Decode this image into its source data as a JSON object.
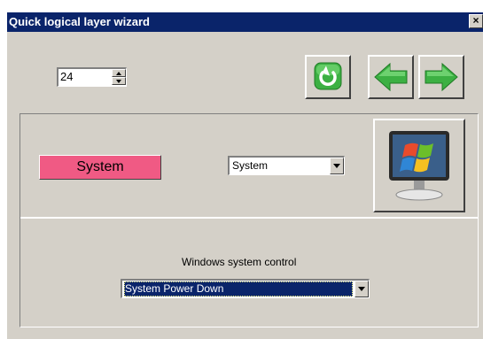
{
  "window": {
    "title": "Quick logical layer wizard",
    "close_label": "×"
  },
  "toolbar": {
    "spin_value": "24"
  },
  "layer": {
    "name_label": "System",
    "type_select_value": "System"
  },
  "control": {
    "label": "Windows system control",
    "select_value": "System Power Down"
  },
  "icons": {
    "refresh": "refresh-icon",
    "back": "arrow-left-icon",
    "forward": "arrow-right-icon",
    "monitor": "windows-monitor-icon"
  },
  "colors": {
    "titlebar": "#0a246a",
    "dialog_bg": "#d4d0c8",
    "name_highlight": "#f05a84",
    "green_icon": "#3cb043"
  }
}
